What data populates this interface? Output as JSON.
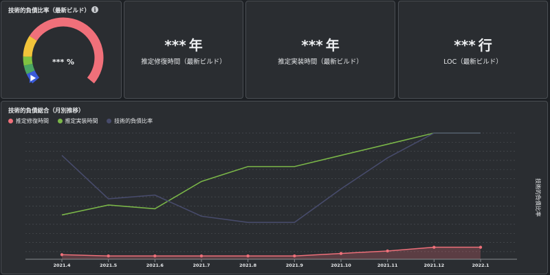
{
  "gauge_panel": {
    "title": "技術的負債比率（最新ビルド）",
    "info_icon": "info-icon",
    "value_text": "*** %",
    "value_fraction": 0.92,
    "segments": [
      {
        "color": "#3a5bd9",
        "fraction": 0.06
      },
      {
        "color": "#4aa564",
        "fraction": 0.05
      },
      {
        "color": "#7fc241",
        "fraction": 0.05
      },
      {
        "color": "#f2c43a",
        "fraction": 0.12
      },
      {
        "color": "#f0707a",
        "fraction": 0.72
      }
    ]
  },
  "stats": [
    {
      "value": "***",
      "unit": "年",
      "label": "推定修復時間（最新ビルド）"
    },
    {
      "value": "***",
      "unit": "年",
      "label": "推定実装時間（最新ビルド）"
    },
    {
      "value": "***",
      "unit": "行",
      "label": "LOC（最新ビルド）"
    }
  ],
  "chart_panel": {
    "title": "技術的負債総合（月別推移）",
    "right_axis_label": "技術的負債比率"
  },
  "chart_data": {
    "type": "line",
    "title": "技術的負債総合（月別推移）",
    "categories": [
      "2021.4",
      "2021.5",
      "2021.6",
      "2021.7",
      "2021.8",
      "2021.9",
      "2021.10",
      "2021.11",
      "2021.12",
      "2022.1"
    ],
    "ylabel_right": "技術的負債比率",
    "ylim": [
      0,
      100
    ],
    "grid": true,
    "legend_position": "top-left",
    "series": [
      {
        "name": "推定修復時間",
        "color": "#f0707a",
        "style": "area-dots",
        "values": [
          2,
          1,
          1,
          1,
          1,
          1,
          3,
          5,
          8,
          8
        ]
      },
      {
        "name": "推定実装時間",
        "color": "#7ab648",
        "style": "line",
        "values": [
          34,
          42,
          39,
          61,
          73,
          73,
          82,
          91,
          100,
          100
        ]
      },
      {
        "name": "技術的負債比率",
        "color": "#474b6b",
        "style": "line",
        "values": [
          82,
          47,
          50,
          33,
          28,
          28,
          55,
          80,
          100,
          100
        ]
      }
    ]
  }
}
